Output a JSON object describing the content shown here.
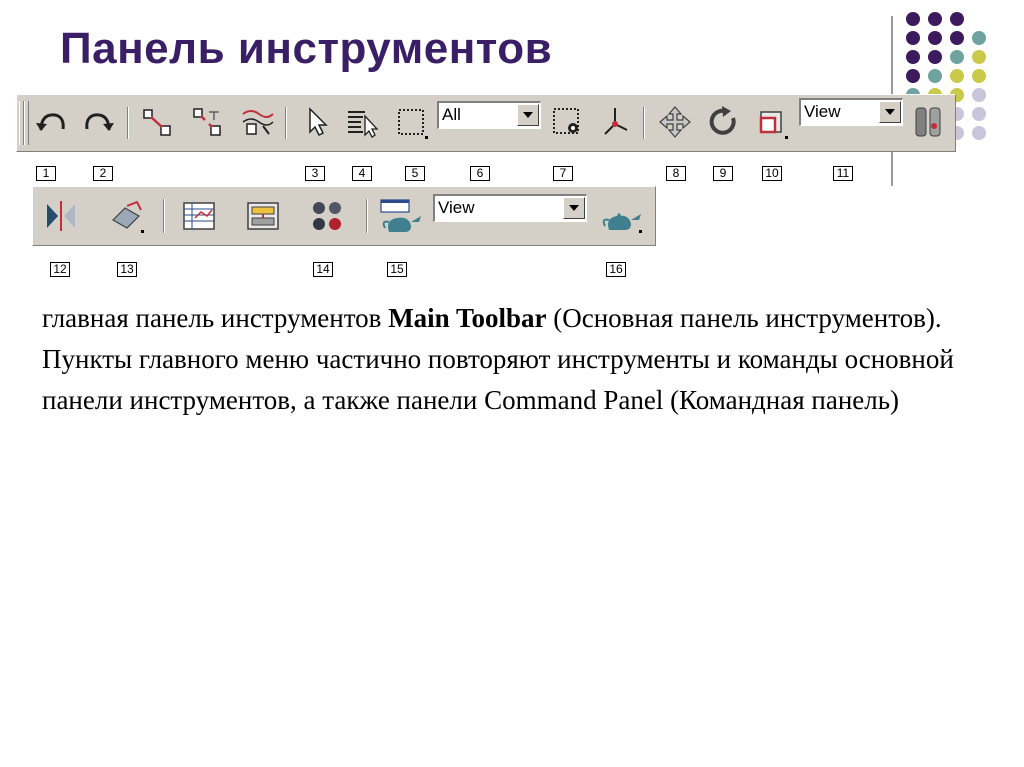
{
  "slide": {
    "title": "Панель инструментов"
  },
  "toolbar_main": {
    "selection_filter_value": "All",
    "coord_system_value": "View"
  },
  "toolbar_second": {
    "render_view_value": "View"
  },
  "callouts": [
    "1",
    "2",
    "3",
    "4",
    "5",
    "6",
    "7",
    "8",
    "9",
    "10",
    "11",
    "12",
    "13",
    "14",
    "15",
    "16"
  ],
  "caption": {
    "part1": "главная панель инструментов ",
    "bold": "Main Toolbar",
    "part2": " (Основная панель инструментов). Пункты главного меню частично повторяют инструменты и команды основной панели инструментов, а также панели Command Panel (Командная панель)"
  },
  "colors": {
    "title": "#3a1f66",
    "toolbar_bg": "#d4d0c8",
    "dot_purple": "#3d1a5e",
    "dot_teal": "#6fa3a0",
    "dot_yellow": "#c9c94a",
    "dot_lavender": "#c9c6dc"
  }
}
